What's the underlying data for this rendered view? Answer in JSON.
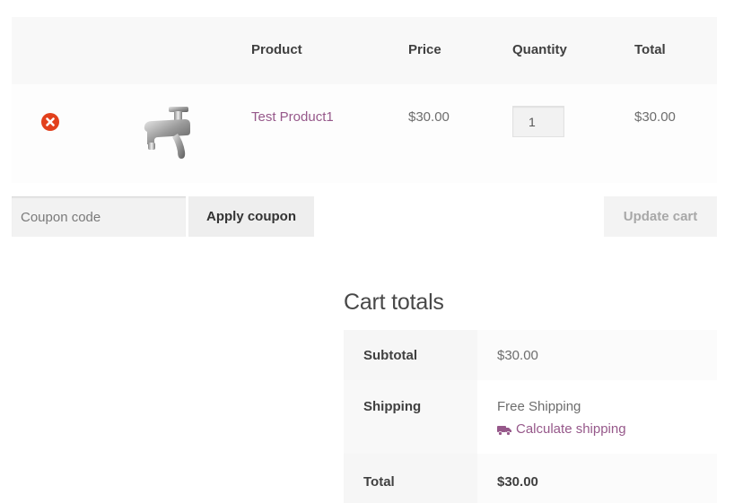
{
  "cart_table": {
    "headers": {
      "product": "Product",
      "price": "Price",
      "quantity": "Quantity",
      "total": "Total"
    },
    "items": [
      {
        "name": "Test Product1",
        "price": "$30.00",
        "quantity": "1",
        "total": "$30.00",
        "image_icon": "faucet-tap-image"
      }
    ]
  },
  "actions": {
    "coupon_placeholder": "Coupon code",
    "apply_coupon_label": "Apply coupon",
    "update_cart_label": "Update cart"
  },
  "cart_totals": {
    "heading": "Cart totals",
    "subtotal_label": "Subtotal",
    "subtotal_value": "$30.00",
    "shipping_label": "Shipping",
    "shipping_value": "Free Shipping",
    "calculate_shipping_label": "Calculate shipping",
    "total_label": "Total",
    "total_value": "$30.00"
  },
  "colors": {
    "link": "#96588a",
    "remove": "#e2401c",
    "header_bg": "#f8f8f8"
  }
}
